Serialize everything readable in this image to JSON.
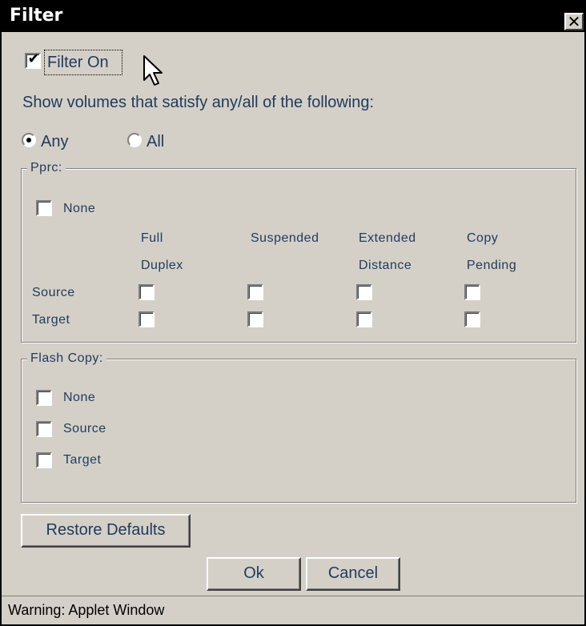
{
  "window": {
    "title": "Filter",
    "close_glyph": "✕"
  },
  "filter_on": {
    "label": "Filter On",
    "checked": true
  },
  "instruction": "Show volumes that satisfy any/all of the following:",
  "match_mode": {
    "any_label": "Any",
    "all_label": "All",
    "selected": "Any"
  },
  "pprc": {
    "legend": "Pprc:",
    "none_label": "None",
    "columns": [
      {
        "line1": "Full",
        "line2": "Duplex"
      },
      {
        "line1": "Suspended",
        "line2": ""
      },
      {
        "line1": "Extended",
        "line2": "Distance"
      },
      {
        "line1": "Copy",
        "line2": "Pending"
      }
    ],
    "rows": [
      "Source",
      "Target"
    ]
  },
  "flash_copy": {
    "legend": "Flash Copy:",
    "options": [
      "None",
      "Source",
      "Target"
    ]
  },
  "buttons": {
    "restore": "Restore Defaults",
    "ok": "Ok",
    "cancel": "Cancel"
  },
  "status": "Warning: Applet Window",
  "colors": {
    "label_text": "#1f3a5c",
    "dialog_bg": "#d4d0c8",
    "title_bg": "#000000"
  },
  "icons": {
    "cursor": "arrow-cursor-icon",
    "close": "close-icon"
  }
}
